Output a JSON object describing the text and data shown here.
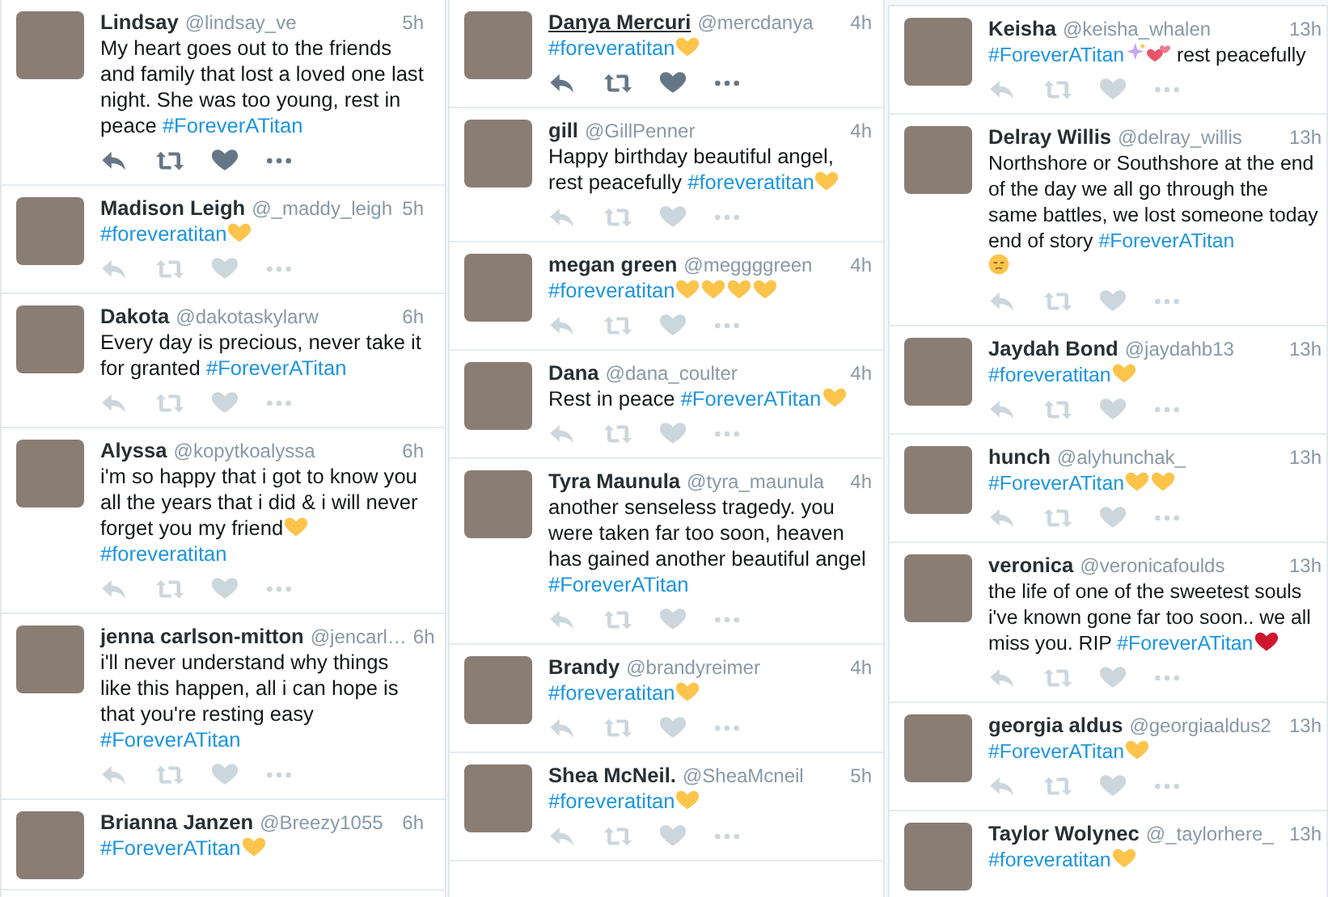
{
  "columns": [
    {
      "tweets": [
        {
          "name": "Lindsay",
          "handle": "@lindsay_ve",
          "time": "5h",
          "name_underlined": false,
          "actions": {
            "highlighted": true
          },
          "body": [
            {
              "kind": "text",
              "text": "My heart goes out to the friends and family that lost a loved one last night. She was too young, rest in peace "
            },
            {
              "kind": "tag",
              "text": "#ForeverATitan"
            }
          ]
        },
        {
          "name": "Madison Leigh",
          "handle": "@_maddy_leigh",
          "time": "5h",
          "name_underlined": false,
          "actions": {
            "highlighted": false
          },
          "body": [
            {
              "kind": "tag",
              "text": "#foreveratitan"
            },
            {
              "kind": "heart",
              "color": "#fcc44b"
            }
          ]
        },
        {
          "name": "Dakota",
          "handle": "@dakotaskylarw",
          "time": "6h",
          "name_underlined": false,
          "actions": {
            "highlighted": false
          },
          "body": [
            {
              "kind": "text",
              "text": "Every day is precious, never take it for granted "
            },
            {
              "kind": "tag",
              "text": "#ForeverATitan"
            }
          ]
        },
        {
          "name": "Alyssa",
          "handle": "@kopytkoalyssa",
          "time": "6h",
          "name_underlined": false,
          "actions": {
            "highlighted": false
          },
          "body": [
            {
              "kind": "text",
              "text": "i'm so happy that i got to know you all the years that i did & i will never forget you my friend"
            },
            {
              "kind": "heart",
              "color": "#fcc44b"
            },
            {
              "kind": "break"
            },
            {
              "kind": "tag",
              "text": "#foreveratitan"
            }
          ]
        },
        {
          "name": "jenna carlson-mitton",
          "handle": "@jencarl…",
          "time": "6h",
          "name_underlined": false,
          "actions": {
            "highlighted": false
          },
          "body": [
            {
              "kind": "text",
              "text": "i'll never understand why things like this happen, all i can hope is that you're resting easy"
            },
            {
              "kind": "break"
            },
            {
              "kind": "tag",
              "text": "#ForeverATitan"
            }
          ]
        },
        {
          "name": "Brianna Janzen",
          "handle": "@Breezy1055",
          "time": "6h",
          "name_underlined": false,
          "body": [
            {
              "kind": "tag",
              "text": "#ForeverATitan"
            },
            {
              "kind": "heart",
              "color": "#fcc44b"
            }
          ]
        }
      ]
    },
    {
      "tweets": [
        {
          "name": "Danya Mercuri",
          "handle": "@mercdanya",
          "time": "4h",
          "name_underlined": true,
          "actions": {
            "highlighted": true
          },
          "body": [
            {
              "kind": "tag",
              "text": "#foreveratitan"
            },
            {
              "kind": "heart",
              "color": "#fcc44b"
            }
          ]
        },
        {
          "name": "gill",
          "handle": "@GillPenner",
          "time": "4h",
          "name_underlined": false,
          "actions": {
            "highlighted": false
          },
          "body": [
            {
              "kind": "text",
              "text": "Happy birthday beautiful angel, rest peacefully "
            },
            {
              "kind": "tag",
              "text": "#foreveratitan"
            },
            {
              "kind": "heart",
              "color": "#fcc44b"
            }
          ]
        },
        {
          "name": "megan green",
          "handle": "@meggggreen",
          "time": "4h",
          "name_underlined": false,
          "actions": {
            "highlighted": false
          },
          "body": [
            {
              "kind": "tag",
              "text": "#foreveratitan"
            },
            {
              "kind": "heart",
              "color": "#fcc44b"
            },
            {
              "kind": "heart",
              "color": "#fcc44b"
            },
            {
              "kind": "heart",
              "color": "#fcc44b"
            },
            {
              "kind": "heart",
              "color": "#fcc44b"
            }
          ]
        },
        {
          "name": "Dana",
          "handle": "@dana_coulter",
          "time": "4h",
          "name_underlined": false,
          "actions": {
            "highlighted": false
          },
          "body": [
            {
              "kind": "text",
              "text": "Rest in peace "
            },
            {
              "kind": "tag",
              "text": "#ForeverATitan"
            },
            {
              "kind": "heart",
              "color": "#fcc44b"
            }
          ]
        },
        {
          "name": "Tyra Maunula",
          "handle": "@tyra_maunula",
          "time": "4h",
          "name_underlined": false,
          "actions": {
            "highlighted": false
          },
          "body": [
            {
              "kind": "text",
              "text": "another senseless tragedy. you were taken far too soon, heaven has gained another beautiful angel"
            },
            {
              "kind": "break"
            },
            {
              "kind": "tag",
              "text": "#ForeverATitan"
            }
          ]
        },
        {
          "name": "Brandy",
          "handle": "@brandyreimer",
          "time": "4h",
          "name_underlined": false,
          "actions": {
            "highlighted": false
          },
          "body": [
            {
              "kind": "tag",
              "text": "#foreveratitan"
            },
            {
              "kind": "heart",
              "color": "#fcc44b"
            }
          ]
        },
        {
          "name": "Shea McNeil.",
          "handle": "@SheaMcneil",
          "time": "5h",
          "name_underlined": false,
          "actions": {
            "highlighted": false
          },
          "body": [
            {
              "kind": "tag",
              "text": "#foreveratitan"
            },
            {
              "kind": "heart",
              "color": "#fcc44b"
            }
          ]
        }
      ]
    },
    {
      "tweets": [
        {
          "name": "Keisha",
          "handle": "@keisha_whalen",
          "time": "13h",
          "name_underlined": false,
          "actions": {
            "highlighted": false
          },
          "body": [
            {
              "kind": "tag",
              "text": "#ForeverATitan"
            },
            {
              "kind": "sparkles"
            },
            {
              "kind": "two-hearts"
            },
            {
              "kind": "text",
              "text": " rest peacefully"
            }
          ]
        },
        {
          "name": "Delray Willis",
          "handle": "@delray_willis",
          "time": "13h",
          "name_underlined": false,
          "actions": {
            "highlighted": false
          },
          "body": [
            {
              "kind": "text",
              "text": "Northshore or Southshore at the end of the day we all go through the same battles, we lost someone today end of story "
            },
            {
              "kind": "tag",
              "text": "#ForeverATitan"
            },
            {
              "kind": "break"
            },
            {
              "kind": "sad-face"
            }
          ]
        },
        {
          "name": "Jaydah Bond",
          "handle": "@jaydahb13",
          "time": "13h",
          "name_underlined": false,
          "actions": {
            "highlighted": false
          },
          "body": [
            {
              "kind": "tag",
              "text": "#foreveratitan"
            },
            {
              "kind": "heart",
              "color": "#fcc44b"
            }
          ]
        },
        {
          "name": "hunch",
          "handle": "@alyhunchak_",
          "time": "13h",
          "name_underlined": false,
          "actions": {
            "highlighted": false
          },
          "body": [
            {
              "kind": "tag",
              "text": "#ForeverATitan"
            },
            {
              "kind": "heart",
              "color": "#fcc44b"
            },
            {
              "kind": "heart",
              "color": "#fcc44b"
            }
          ]
        },
        {
          "name": "veronica",
          "handle": "@veronicafoulds",
          "time": "13h",
          "name_underlined": false,
          "actions": {
            "highlighted": false
          },
          "body": [
            {
              "kind": "text",
              "text": "the life of one of the sweetest souls i've known gone far too soon.. we all miss you. RIP "
            },
            {
              "kind": "tag",
              "text": "#ForeverATitan"
            },
            {
              "kind": "heart",
              "color": "#d0152f"
            }
          ]
        },
        {
          "name": "georgia aldus",
          "handle": "@georgiaaldus2",
          "time": "13h",
          "name_underlined": false,
          "actions": {
            "highlighted": false
          },
          "body": [
            {
              "kind": "tag",
              "text": "#ForeverATitan"
            },
            {
              "kind": "heart",
              "color": "#fcc44b"
            }
          ]
        },
        {
          "name": "Taylor Wolynec",
          "handle": "@_taylorhere_",
          "time": "13h",
          "name_underlined": false,
          "body": [
            {
              "kind": "tag",
              "text": "#foreveratitan"
            },
            {
              "kind": "heart",
              "color": "#fcc44b"
            }
          ]
        }
      ]
    }
  ]
}
